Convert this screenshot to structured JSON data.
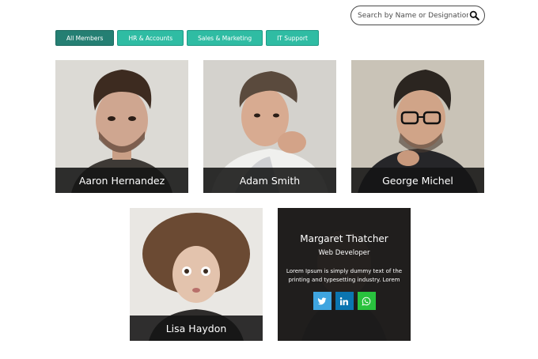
{
  "search": {
    "placeholder": "Search by Name or Designation"
  },
  "filters": [
    {
      "label": "All Members",
      "active": true
    },
    {
      "label": "HR & Accounts",
      "active": false
    },
    {
      "label": "Sales & Marketing",
      "active": false
    },
    {
      "label": "IT Support",
      "active": false
    }
  ],
  "members": [
    {
      "name": "Aaron Hernandez"
    },
    {
      "name": "Adam Smith"
    },
    {
      "name": "George Michel"
    },
    {
      "name": "Lisa Haydon"
    },
    {
      "name": "Margaret Thatcher",
      "designation": "Web Developer",
      "bio": "Lorem Ipsum is simply dummy text of the printing and typesetting industry. Lorem",
      "socials": [
        {
          "icon": "twitter-icon",
          "color": "#3fa5e0"
        },
        {
          "icon": "linkedin-icon",
          "color": "#0b75b0"
        },
        {
          "icon": "whatsapp-icon",
          "color": "#29c23e"
        }
      ]
    }
  ],
  "colors": {
    "accent": "#2fbca3",
    "active": "#257f73",
    "caption_bg": "#141414"
  }
}
